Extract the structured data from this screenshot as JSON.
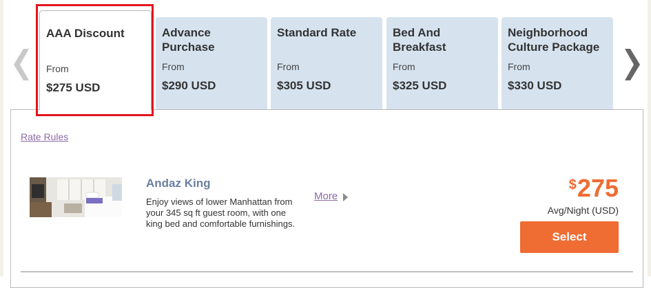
{
  "tabs": [
    {
      "name": "AAA Discount",
      "from": "From",
      "price": "$275 USD",
      "active": true
    },
    {
      "name": "Advance Purchase",
      "from": "From",
      "price": "$290 USD",
      "active": false
    },
    {
      "name": "Standard Rate",
      "from": "From",
      "price": "$305 USD",
      "active": false
    },
    {
      "name": "Bed And Breakfast",
      "from": "From",
      "price": "$325 USD",
      "active": false
    },
    {
      "name": "Neighborhood Culture Package",
      "from": "From",
      "price": "$330 USD",
      "active": false
    }
  ],
  "nav": {
    "prev_icon": "chevron-left-icon",
    "next_icon": "chevron-right-icon"
  },
  "rate_rules": "Rate Rules",
  "room": {
    "title": "Andaz King",
    "description": "Enjoy views of lower Manhattan from your 345 sq ft guest room, with one king bed and comfortable furnishings.",
    "more": "More",
    "price_currency": "$",
    "price_amount": "275",
    "price_unit": "Avg/Night (USD)",
    "select": "Select"
  },
  "colors": {
    "accent": "#ef6c33",
    "tab_bg": "#d6e3ef",
    "link": "#8d6aa8",
    "highlight": "#e3141b",
    "room_title": "#6a7fa0"
  }
}
